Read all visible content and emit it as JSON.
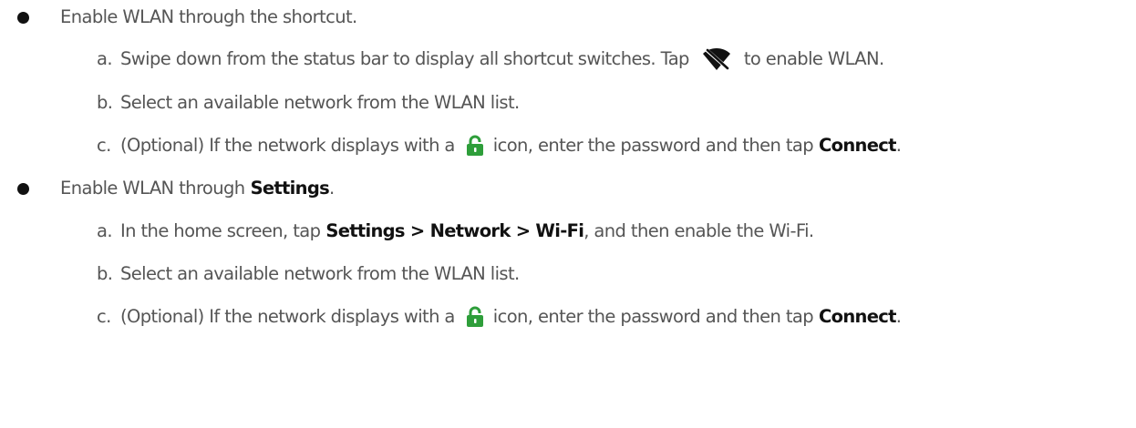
{
  "section1": {
    "heading": "Enable WLAN through the shortcut.",
    "steps": [
      {
        "marker": "a.",
        "text_before": "Swipe down from the status bar to display all shortcut switches. Tap",
        "icon": "wifi-off-icon",
        "text_after": "to enable WLAN."
      },
      {
        "marker": "b.",
        "text": "Select an available network from the WLAN list."
      },
      {
        "marker": "c.",
        "text_before": "(Optional) If the network displays with a",
        "icon": "lock-icon",
        "text_middle": "icon, enter the password and then tap",
        "bold": "Connect",
        "text_after": "."
      }
    ]
  },
  "section2": {
    "heading_before": "Enable WLAN through",
    "heading_bold": "Settings",
    "heading_after": ".",
    "steps": [
      {
        "marker": "a.",
        "text_before": "In the home screen, tap",
        "bold": "Settings > Network > Wi-Fi",
        "text_after": ", and then enable the Wi-Fi."
      },
      {
        "marker": "b.",
        "text": "Select an available network from the WLAN list."
      },
      {
        "marker": "c.",
        "text_before": "(Optional) If the network displays with a",
        "icon": "lock-icon",
        "text_middle": "icon, enter the password and then tap",
        "bold": "Connect",
        "text_after": "."
      }
    ]
  },
  "colors": {
    "text": "#555555",
    "bold_text": "#111111",
    "icon": "#111111",
    "lock_icon": "#2e9e3a"
  }
}
